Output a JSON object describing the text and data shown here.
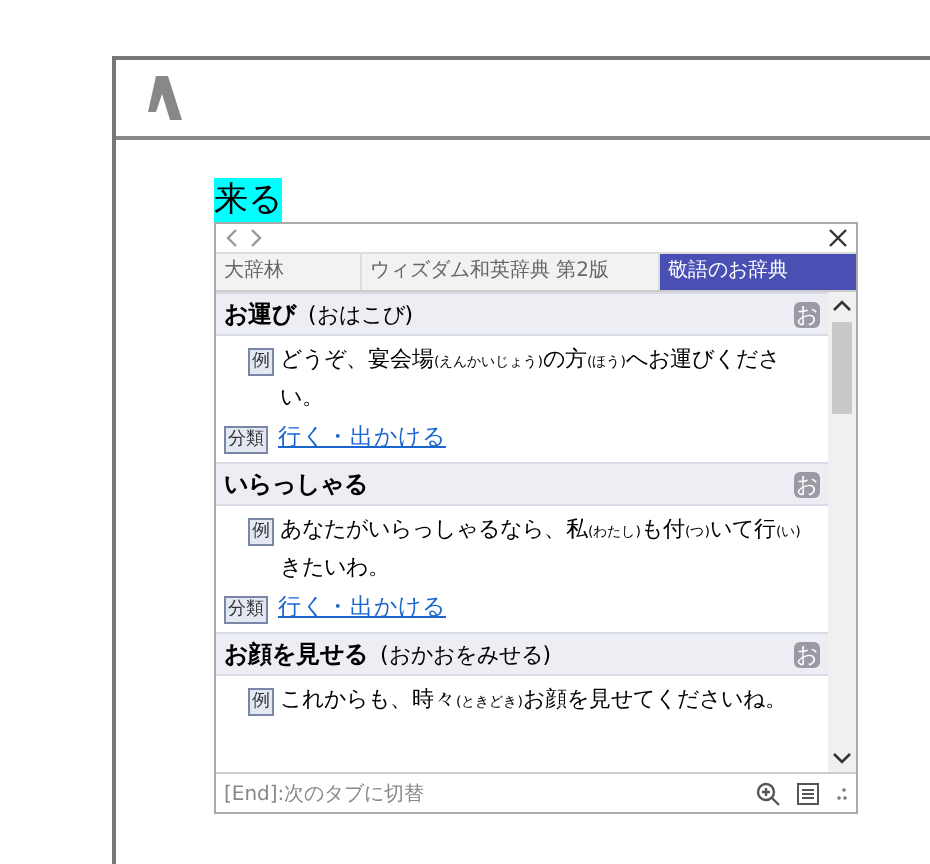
{
  "word": "来る",
  "popup": {
    "tabs": [
      {
        "label": "大辞林",
        "selected": false
      },
      {
        "label": "ウィズダム和英辞典 第2版",
        "selected": false
      },
      {
        "label": "敬語のお辞典",
        "selected": true
      }
    ],
    "entries": [
      {
        "headword": "お運び",
        "reading": "(おはこび)",
        "mark": "お",
        "example_badge": "例",
        "example": "どうぞ、宴会場$_{(えんかいじょう)}$の方$_{(ほう)}$へお運びください。",
        "category_badge": "分類",
        "category": "行く・出かける"
      },
      {
        "headword": "いらっしゃる",
        "mark": "お",
        "example_badge": "例",
        "example": "あなたがいらっしゃるなら、私$_{(わたし)}$も付$_{(つ)}$いて行$_{(い)}$きたいわ。",
        "category_badge": "分類",
        "category": "行く・出かける"
      },
      {
        "headword": "お顔を見せる",
        "reading": "(おかおをみせる)",
        "mark": "お",
        "example_badge": "例",
        "example": "これからも、時々$_{(ときどき)}$お顔を見せてくださいね。"
      }
    ],
    "status": "[End]:次のタブに切替"
  }
}
